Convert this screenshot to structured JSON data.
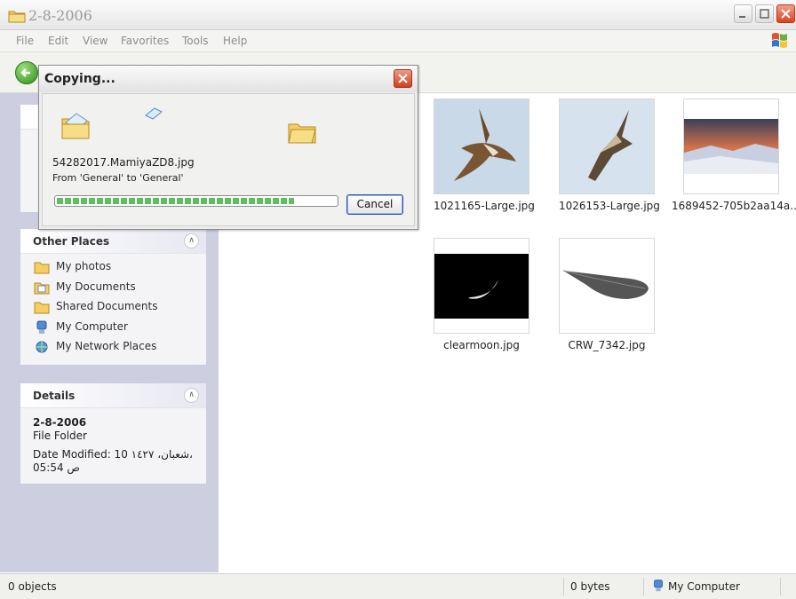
{
  "window": {
    "title": "2-8-2006",
    "icon": "folder-icon"
  },
  "menu": [
    "File",
    "Edit",
    "View",
    "Favorites",
    "Tools",
    "Help"
  ],
  "dialog": {
    "title": "Copying...",
    "filename": "54282017.MamiyaZD8.jpg",
    "from_to": "From 'General' to 'General'",
    "progress": 0.85,
    "cancel_label": "Cancel"
  },
  "sidebar": {
    "other_places": {
      "title": "Other Places",
      "items": [
        {
          "label": "My photos",
          "icon": "folder-icon"
        },
        {
          "label": "My Documents",
          "icon": "documents-icon"
        },
        {
          "label": "Shared Documents",
          "icon": "folder-icon"
        },
        {
          "label": "My Computer",
          "icon": "computer-icon"
        },
        {
          "label": "My Network Places",
          "icon": "network-icon"
        }
      ]
    },
    "details": {
      "title": "Details",
      "name": "2-8-2006",
      "type": "File Folder",
      "modified_line1": "Date Modified: 10 شعبان، ١٤٢٧،",
      "modified_line2": "05:54 ص"
    }
  },
  "files": [
    {
      "name": "1021165-Large.jpg",
      "kind": "eagle"
    },
    {
      "name": "1026153-Large.jpg",
      "kind": "falcon"
    },
    {
      "name": "1689452-705b2aa14a...",
      "kind": "sunset"
    },
    {
      "name": "clearmoon.jpg",
      "kind": "moon"
    },
    {
      "name": "CRW_7342.jpg",
      "kind": "feather"
    }
  ],
  "status": {
    "objects": "0 objects",
    "size": "0 bytes",
    "location": "My Computer"
  },
  "colors": {
    "sidebar_bg": "#cdcfe0",
    "close_red": "#d8421c",
    "progress_green": "#5fbf5f"
  }
}
